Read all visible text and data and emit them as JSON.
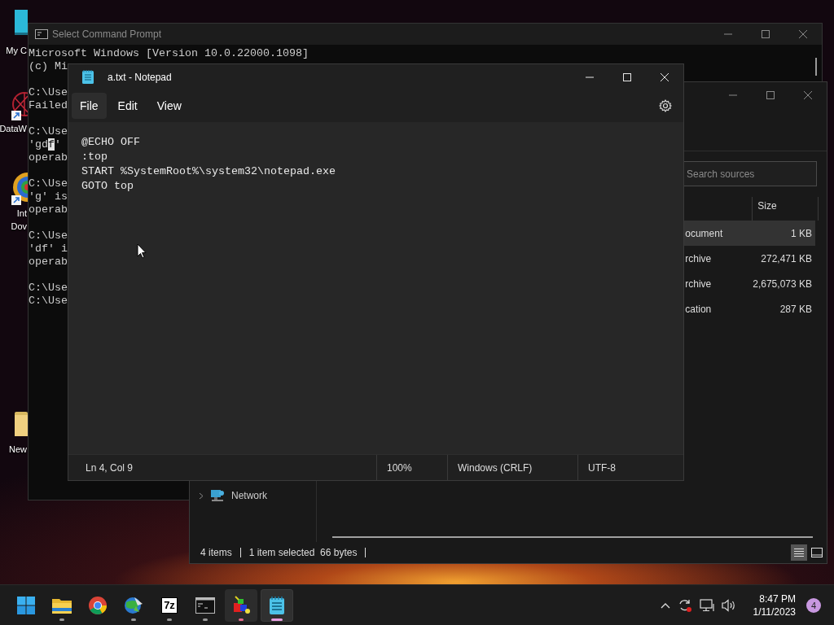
{
  "desktop": {
    "icons": [
      {
        "kind": "monitor",
        "shortcut": false,
        "label_lines": [
          "My C"
        ]
      },
      {
        "kind": "web",
        "shortcut": true,
        "label_lines": [
          "DataW"
        ]
      },
      {
        "kind": "ring",
        "shortcut": true,
        "label_lines": [
          "Int",
          "Dov"
        ]
      },
      {
        "kind": "folder",
        "shortcut": false,
        "label_lines": [
          "New"
        ]
      }
    ]
  },
  "command_prompt": {
    "title": "Select Command Prompt",
    "blocks": [
      [
        {
          "text": "Microsoft Windows [Version 10.0.22000.1098]"
        },
        {
          "text": "(c) Mi"
        }
      ],
      [
        {
          "text": "C:\\Use"
        },
        {
          "text": "Failed"
        }
      ],
      [
        {
          "text": "C:\\Use"
        },
        {
          "text": "'gd",
          "highlight": "f",
          "after": "'"
        },
        {
          "text": "operab"
        }
      ],
      [
        {
          "text": "C:\\Use"
        },
        {
          "text": "'g' is"
        },
        {
          "text": "operab"
        }
      ],
      [
        {
          "text": "C:\\Use"
        },
        {
          "text": "'df' i"
        },
        {
          "text": "operab"
        }
      ],
      [
        {
          "text": "C:\\Use"
        },
        {
          "text": "C:\\Use"
        }
      ]
    ]
  },
  "explorer": {
    "search": {
      "placeholder": "Search sources"
    },
    "size_column": "Size",
    "rows": [
      {
        "name": "ocument",
        "size": "1 KB",
        "selected": true
      },
      {
        "name": "rchive",
        "size": "272,471 KB",
        "selected": false
      },
      {
        "name": "rchive",
        "size": "2,675,073 KB",
        "selected": false
      },
      {
        "name": "cation",
        "size": "287 KB",
        "selected": false
      }
    ],
    "nav": [
      {
        "label": "Network",
        "expanded": false
      }
    ],
    "status": {
      "items": "4 items",
      "selection": "1 item selected",
      "selection_size": "66 bytes"
    },
    "views": [
      {
        "kind": "details",
        "selected": true
      },
      {
        "kind": "tiles",
        "selected": false
      }
    ]
  },
  "notepad": {
    "title": "a.txt - Notepad",
    "menu": [
      {
        "label": "File",
        "selected": true
      },
      {
        "label": "Edit",
        "selected": false
      },
      {
        "label": "View",
        "selected": false
      }
    ],
    "lines": [
      "@ECHO OFF",
      ":top",
      "START %SystemRoot%\\system32\\notepad.exe",
      "GOTO top"
    ],
    "status": {
      "position": "Ln 4, Col 9",
      "zoom": "100%",
      "line_endings": "Windows (CRLF)",
      "encoding": "UTF-8"
    }
  },
  "taskbar": {
    "apps": [
      {
        "kind": "start",
        "running": false,
        "focused": false,
        "highlighted": false
      },
      {
        "kind": "folder",
        "running": true,
        "focused": false,
        "highlighted": false
      },
      {
        "kind": "browser",
        "running": false,
        "focused": false,
        "highlighted": false
      },
      {
        "kind": "globe",
        "running": true,
        "focused": false,
        "highlighted": false
      },
      {
        "kind": "archiver",
        "glyph": "7z",
        "running": true,
        "focused": false,
        "highlighted": false
      },
      {
        "kind": "terminal",
        "running": true,
        "focused": false,
        "highlighted": false
      },
      {
        "kind": "blocks",
        "running": true,
        "focused": false,
        "highlighted": true
      },
      {
        "kind": "notepad",
        "running": true,
        "focused": true,
        "highlighted": true
      }
    ],
    "clock": {
      "time": "8:47 PM",
      "date": "1/11/2023"
    },
    "notification_count": "4"
  }
}
